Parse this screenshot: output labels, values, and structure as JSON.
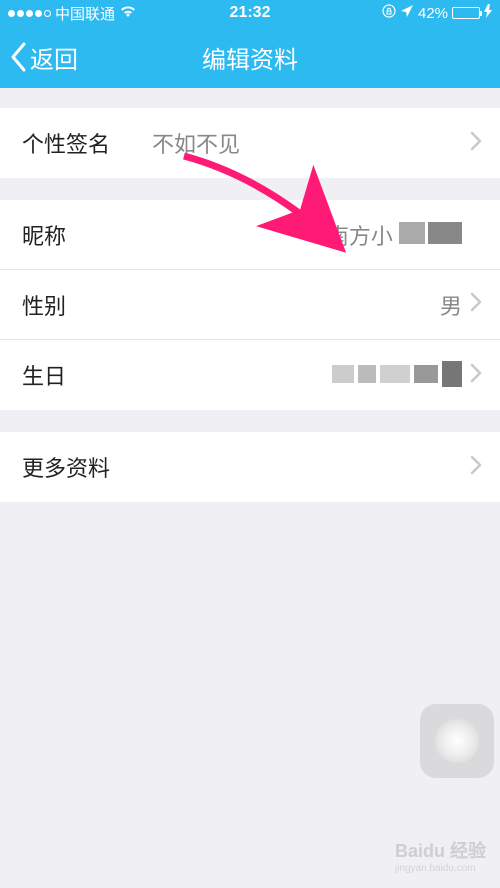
{
  "status": {
    "carrier": "中国联通",
    "time": "21:32",
    "battery_pct": "42%"
  },
  "nav": {
    "back": "返回",
    "title": "编辑资料"
  },
  "rows": {
    "signature": {
      "label": "个性签名",
      "value": "不如不见"
    },
    "nickname": {
      "label": "昵称",
      "value_prefix": "南方小"
    },
    "gender": {
      "label": "性别",
      "value": "男"
    },
    "birthday": {
      "label": "生日"
    },
    "more": {
      "label": "更多资料"
    }
  },
  "watermark": {
    "brand": "Baidu 经验",
    "url": "jingyan.baidu.com"
  }
}
